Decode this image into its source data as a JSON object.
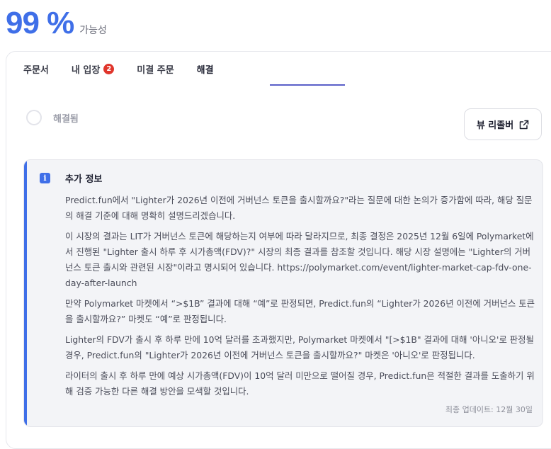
{
  "probability": {
    "value": "99 %",
    "label": "가능성"
  },
  "tabs": [
    {
      "label": "주문서"
    },
    {
      "label": "내 입장",
      "badge": "2"
    },
    {
      "label": "미결 주문"
    },
    {
      "label": "해결"
    }
  ],
  "active_tab": "해결",
  "resolution": {
    "status_label": "해결됨",
    "review_button": "뷰 리졸버"
  },
  "info": {
    "title": "추가 정보",
    "paragraphs": [
      "Predict.fun에서 \"Lighter가 2026년 이전에 거버넌스 토큰을 출시할까요?\"라는 질문에 대한 논의가 증가함에 따라, 해당 질문의 해결 기준에 대해 명확히 설명드리겠습니다.",
      "이 시장의 결과는 LIT가 거버넌스 토큰에 해당하는지 여부에 따라 달라지므로, 최종 결정은 2025년 12월 6일에 Polymarket에서 진행된 \"Lighter 출시 하루 후 시가총액(FDV)?\" 시장의 최종 결과를 참조할 것입니다. 해당 시장 설명에는 \"Lighter의 거버넌스 토큰 출시와 관련된 시장\"이라고 명시되어 있습니다. https://polymarket.com/event/lighter-market-cap-fdv-one-day-after-launch",
      "만약 Polymarket 마켓에서 “>$1B” 결과에 대해 “예”로 판정되면, Predict.fun의 “Lighter가 2026년 이전에 거버넌스 토큰을 출시할까요?” 마켓도 “예”로 판정됩니다.",
      "Lighter의 FDV가 출시 후 하루 만에 10억 달러를 초과했지만, Polymarket 마켓에서 \"[>$1B\" 결과에 대해 '아니오'로 판정될 경우, Predict.fun의 \"Lighter가 2026년 이전에 거버넌스 토큰을 출시할까요?\" 마켓은 '아니오'로 판정됩니다.",
      "라이터의 출시 후 하루 만에 예상 시가총액(FDV)이 10억 달러 미만으로 떨어질 경우, Predict.fun은 적절한 결과를 도출하기 위해 검증 가능한 다른 해결 방안을 모색할 것입니다."
    ],
    "updated": "최종 업데이트: 12월 30일"
  },
  "colors": {
    "accent": "#3f6fe8",
    "badge": "#e0352b",
    "tab_underline": "#5a5fc8"
  }
}
